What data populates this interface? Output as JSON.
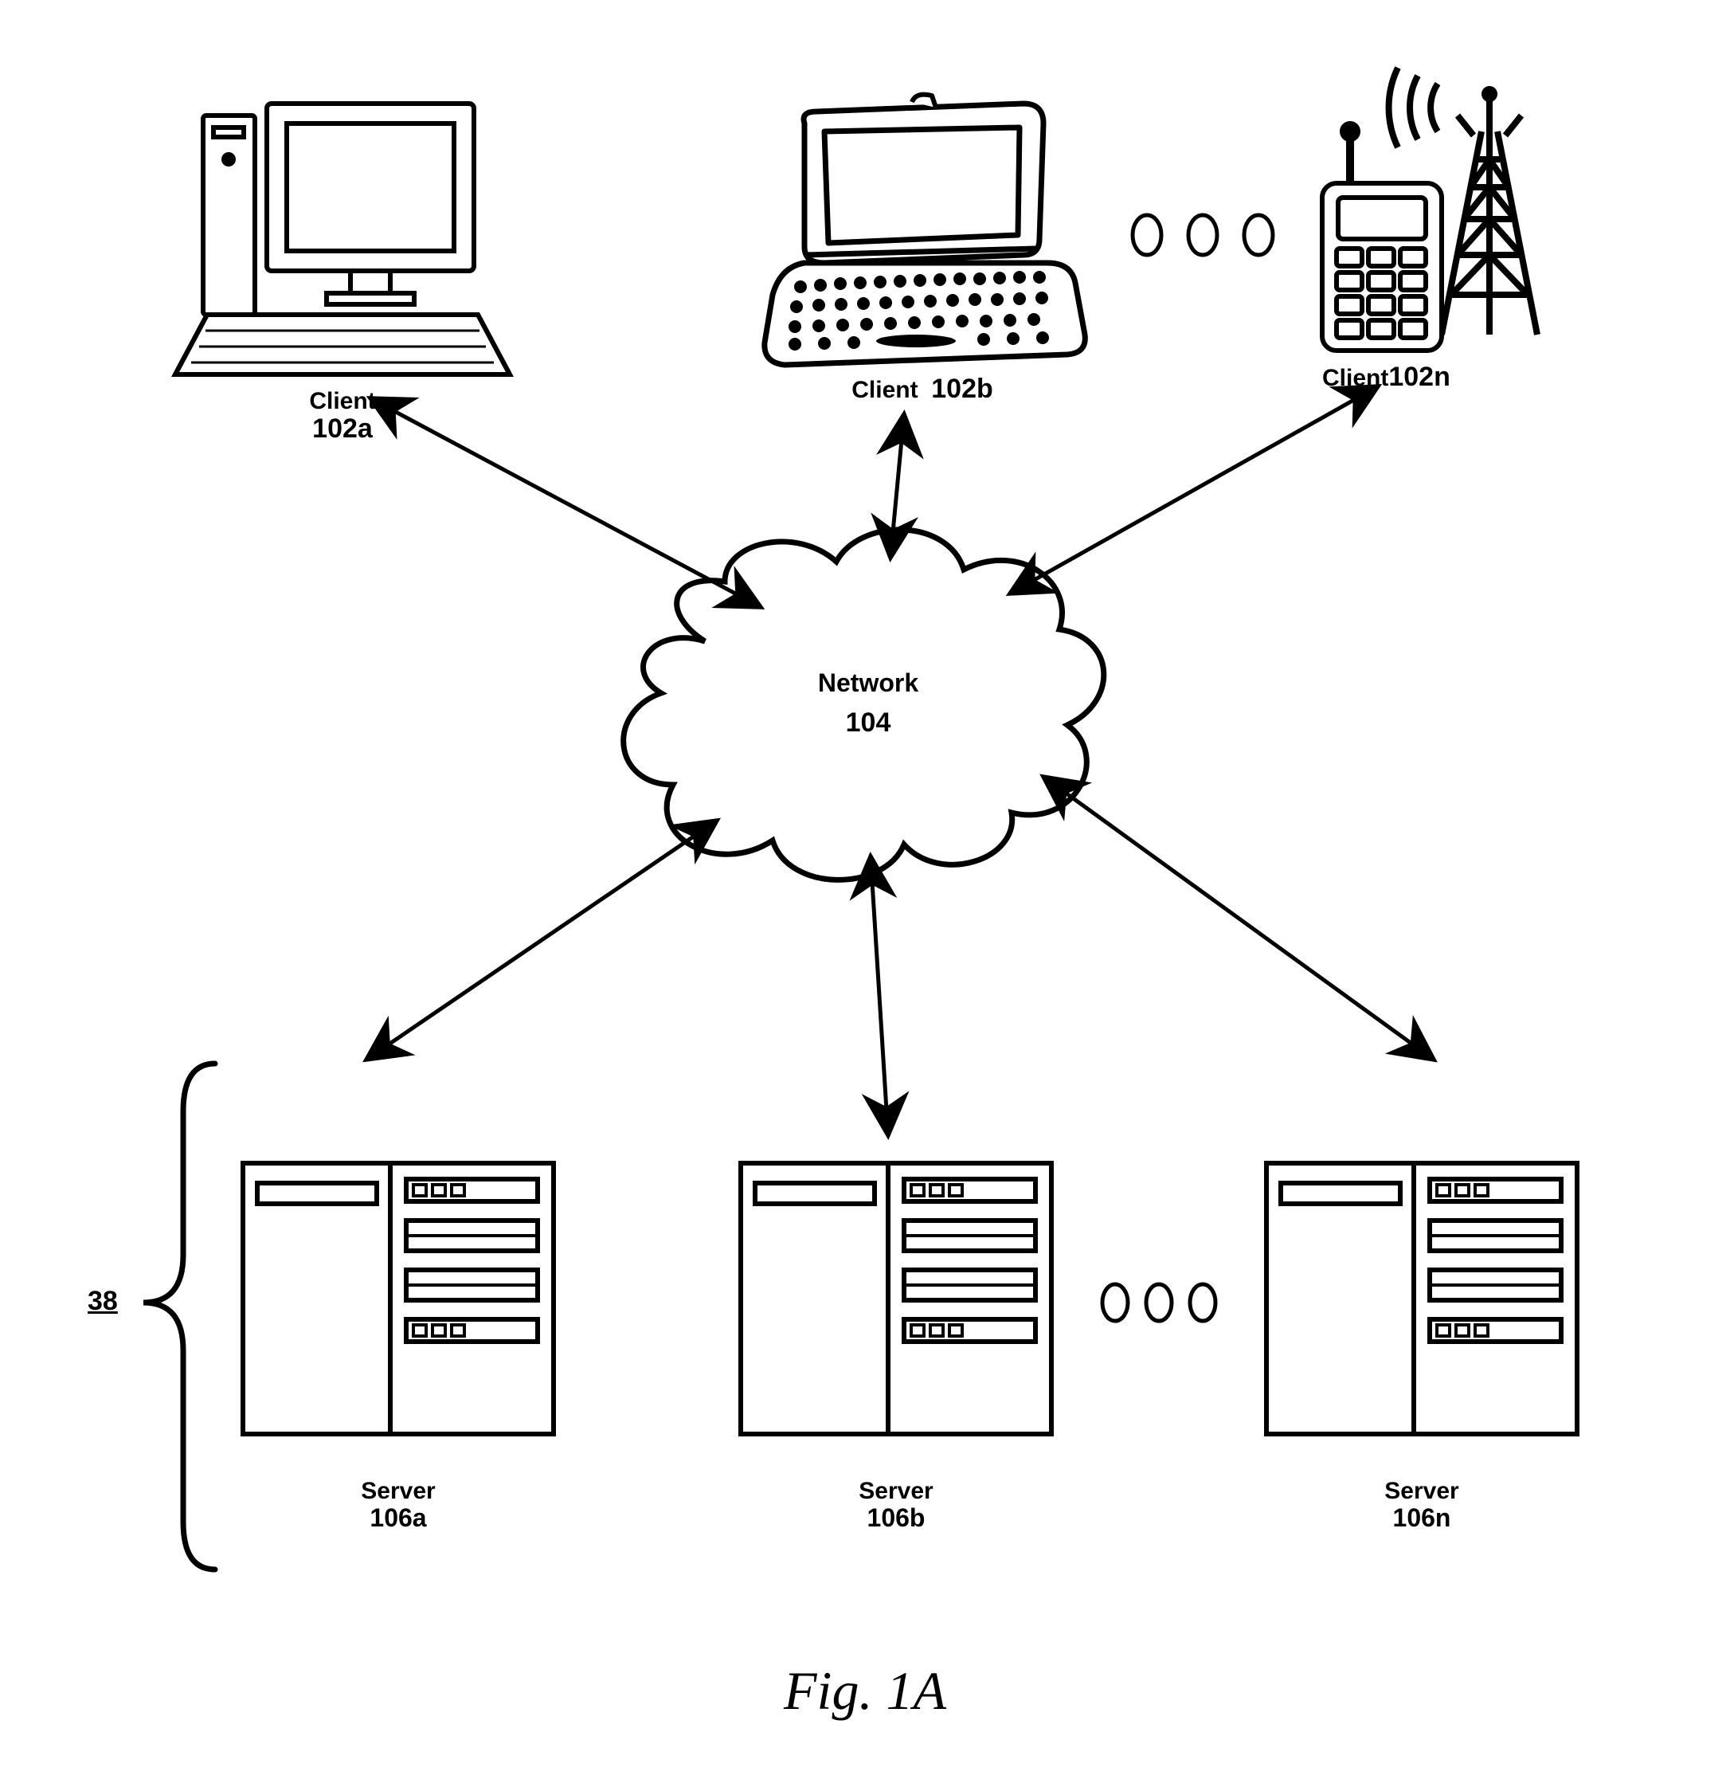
{
  "figure_caption": "Fig. 1A",
  "clients": {
    "a": {
      "label": "Client",
      "ref": "102a"
    },
    "b": {
      "label": "Client",
      "ref": "102b"
    },
    "n": {
      "label": "Client",
      "ref": "102n"
    }
  },
  "network": {
    "label": "Network",
    "ref": "104"
  },
  "servers": {
    "a": {
      "label": "Server",
      "ref": "106a"
    },
    "b": {
      "label": "Server",
      "ref": "106b"
    },
    "n": {
      "label": "Server",
      "ref": "106n"
    }
  },
  "server_group_ref": "38"
}
